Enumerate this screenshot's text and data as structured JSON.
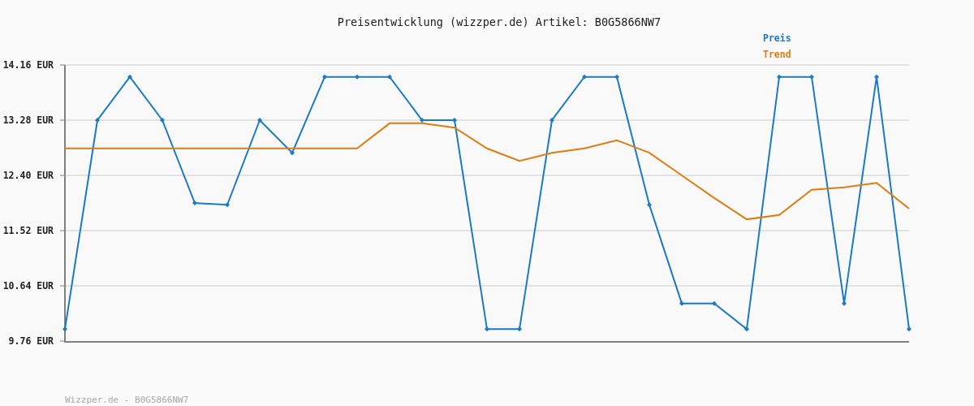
{
  "chart": {
    "chart_data": {
      "type": "line",
      "grid": true,
      "title": "Preisentwicklung (wizzper.de) Artikel: B0G5866NW7",
      "ylim": [
        9.76,
        14.16
      ],
      "yticks": [
        {
          "value": 9.76,
          "label": "9.76 EUR"
        },
        {
          "value": 10.64,
          "label": "10.64 EUR"
        },
        {
          "value": 11.52,
          "label": "11.52 EUR"
        },
        {
          "value": 12.4,
          "label": "12.40 EUR"
        },
        {
          "value": 13.28,
          "label": "13.28 EUR"
        },
        {
          "value": 14.16,
          "label": "14.16 EUR"
        }
      ],
      "series": [
        {
          "name": "Preis",
          "color": "#1a7ac8",
          "marker": "diamond",
          "values": [
            9.95,
            13.28,
            13.97,
            13.28,
            11.96,
            11.93,
            13.28,
            12.76,
            13.97,
            13.97,
            13.97,
            13.28,
            13.28,
            9.95,
            9.95,
            13.28,
            13.97,
            13.97,
            11.93,
            10.36,
            10.36,
            9.95,
            13.97,
            13.97,
            10.36,
            13.97,
            9.95
          ]
        },
        {
          "name": "Trend",
          "color": "#e07c10",
          "values": [
            12.83,
            12.83,
            12.83,
            12.83,
            12.83,
            12.83,
            12.83,
            12.83,
            12.83,
            12.83,
            13.23,
            13.23,
            13.16,
            12.83,
            12.63,
            12.76,
            12.83,
            12.96,
            12.76,
            12.4,
            12.04,
            11.7,
            11.77,
            12.17,
            12.21,
            12.28,
            11.87
          ]
        }
      ]
    }
  },
  "footer": "Wizzper.de - B0G5866NW7"
}
